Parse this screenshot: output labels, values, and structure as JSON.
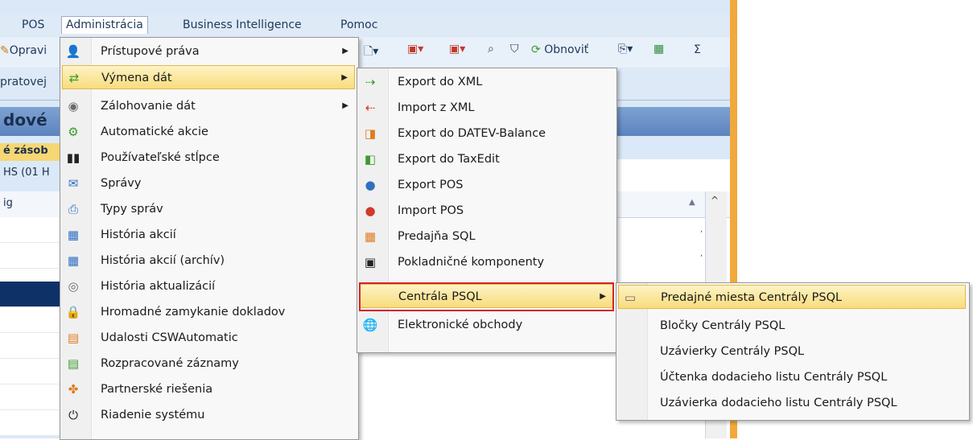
{
  "menubar": {
    "items": [
      "POS",
      "Administrácia",
      "Business Intelligence",
      "Pomoc"
    ]
  },
  "toolbar": {
    "left_fragment": "Opravi",
    "refresh_label": "Obnoviť",
    "sigma": "Σ"
  },
  "toolbar2": {
    "left_fragment": "pratovej"
  },
  "background": {
    "title_fragment": "dové",
    "yellow_fragment": "é zásob",
    "hs_fragment": "HS (01 H",
    "grid_fragment": "ig"
  },
  "admin_menu": {
    "items": [
      {
        "label": "Prístupové práva",
        "icon": "user-key-icon",
        "submenu": true
      },
      {
        "label": "Výmena dát",
        "icon": "exchange-icon",
        "submenu": true
      },
      {
        "label": "Zálohovanie dát",
        "icon": "backup-icon",
        "submenu": true
      },
      {
        "label": "Automatické akcie",
        "icon": "auto-action-icon",
        "submenu": false
      },
      {
        "label": "Používateľské stĺpce",
        "icon": "columns-icon",
        "submenu": false
      },
      {
        "label": "Správy",
        "icon": "message-icon",
        "submenu": false
      },
      {
        "label": "Typy správ",
        "icon": "message-types-icon",
        "submenu": false
      },
      {
        "label": "História akcií",
        "icon": "history-icon",
        "submenu": false
      },
      {
        "label": "História akcií (archív)",
        "icon": "history-archive-icon",
        "submenu": false
      },
      {
        "label": "História aktualizácií",
        "icon": "update-history-icon",
        "submenu": false
      },
      {
        "label": "Hromadné zamykanie dokladov",
        "icon": "lock-docs-icon",
        "submenu": false
      },
      {
        "label": "Udalosti CSWAutomatic",
        "icon": "events-icon",
        "submenu": false
      },
      {
        "label": "Rozpracované záznamy",
        "icon": "draft-records-icon",
        "submenu": false
      },
      {
        "label": "Partnerské riešenia",
        "icon": "partners-icon",
        "submenu": false
      },
      {
        "label": "Riadenie systému",
        "icon": "power-icon",
        "submenu": false
      }
    ]
  },
  "export_menu": {
    "items": [
      {
        "label": "Export do XML",
        "icon": "xml-export-icon"
      },
      {
        "label": "Import z XML",
        "icon": "xml-import-icon"
      },
      {
        "label": "Export do DATEV-Balance",
        "icon": "datev-icon"
      },
      {
        "label": "Export do TaxEdit",
        "icon": "taxedit-icon"
      },
      {
        "label": "Export POS",
        "icon": "pos-export-icon"
      },
      {
        "label": "Import POS",
        "icon": "pos-import-icon"
      },
      {
        "label": "Predajňa SQL",
        "icon": "store-sql-icon"
      },
      {
        "label": "Pokladničné komponenty",
        "icon": "cash-register-icon"
      },
      {
        "label": "Centrála PSQL",
        "icon": "",
        "submenu": true
      },
      {
        "label": "Elektronické obchody",
        "icon": "eshop-icon"
      }
    ]
  },
  "psql_menu": {
    "items": [
      {
        "label": "Predajné miesta Centrály PSQL",
        "icon": "folder-icon"
      },
      {
        "label": "Bločky Centrály PSQL"
      },
      {
        "label": "Uzávierky Centrály PSQL"
      },
      {
        "label": "Účtenka dodacieho listu Centrály PSQL"
      },
      {
        "label": "Uzávierka dodacieho listu Centrály PSQL"
      }
    ]
  },
  "colors": {
    "highlight": "#f8dc7d",
    "annotation_red": "#d8232a",
    "frame_orange": "#f2a93b"
  }
}
